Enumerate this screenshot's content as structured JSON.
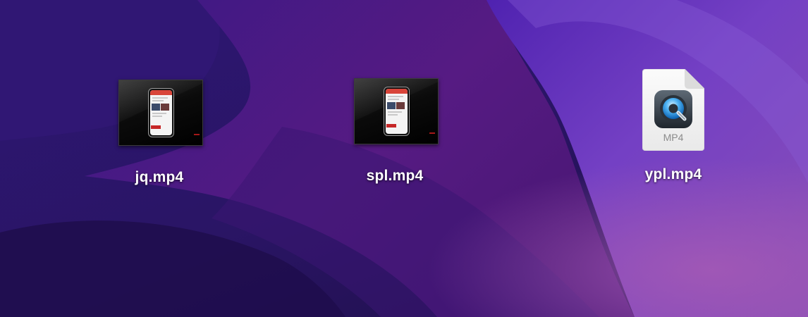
{
  "desktop": {
    "icons": [
      {
        "name": "jq.mp4",
        "kind": "video-thumbnail"
      },
      {
        "name": "spl.mp4",
        "kind": "video-thumbnail"
      },
      {
        "name": "ypl.mp4",
        "kind": "quicktime-document",
        "type_label": "MP4",
        "icon": "quicktime-icon"
      }
    ]
  },
  "colors": {
    "wallpaper_dark": "#23104f",
    "wallpaper_purple": "#5a1f86",
    "wallpaper_violet": "#6a3cc4",
    "wallpaper_pink": "#8d4aa8",
    "label_text": "#ffffff"
  }
}
